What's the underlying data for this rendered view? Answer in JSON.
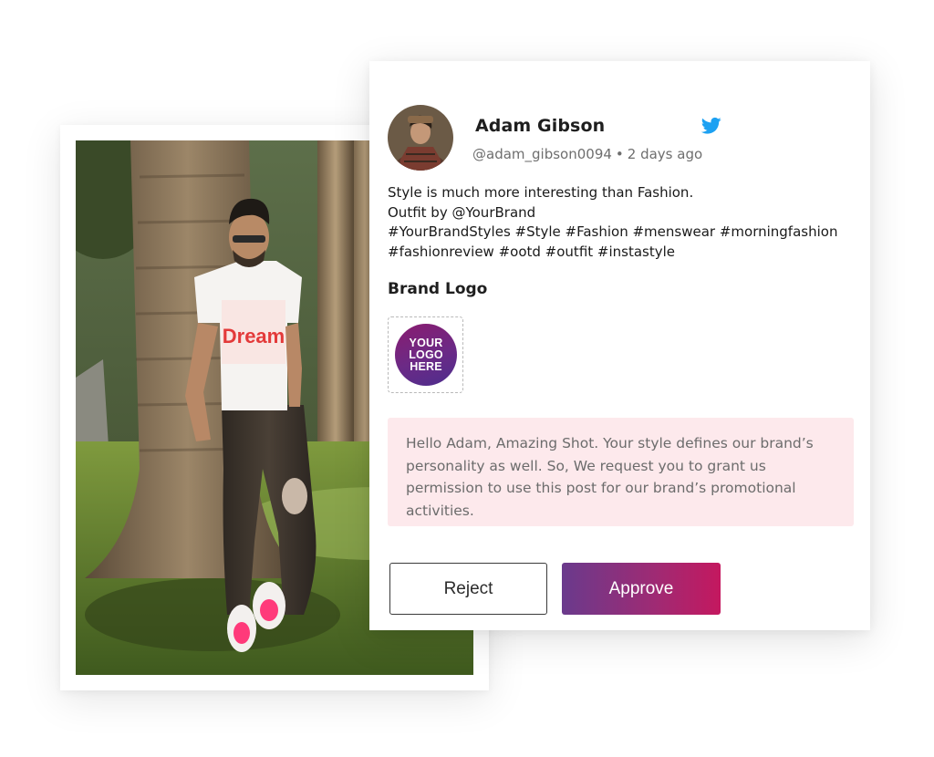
{
  "post": {
    "user_name": "Adam Gibson",
    "handle": "@adam_gibson0094",
    "separator": "•",
    "time_ago": "2 days ago",
    "lines": [
      "Style is much more interesting than Fashion.",
      "Outfit by @YourBrand",
      "#YourBrandStyles #Style #Fashion #menswear #morningfashion",
      "#fashionreview #ootd #outfit #instastyle"
    ],
    "platform_icon": "twitter-icon",
    "platform_color": "#1da1f2"
  },
  "brand": {
    "heading": "Brand Logo",
    "logo_lines": [
      "YOUR",
      "LOGO",
      "HERE"
    ]
  },
  "message": {
    "text": "Hello Adam, Amazing Shot. Your style defines our brand’s personality as well. So, We request you to grant us permission to use this post for our brand’s promotional activities."
  },
  "actions": {
    "reject_label": "Reject",
    "approve_label": "Approve"
  },
  "photo": {
    "shirt_text": "Dream"
  },
  "colors": {
    "message_bg": "#fde9ec",
    "approve_start": "#6a3a8c",
    "approve_end": "#c4185f"
  }
}
